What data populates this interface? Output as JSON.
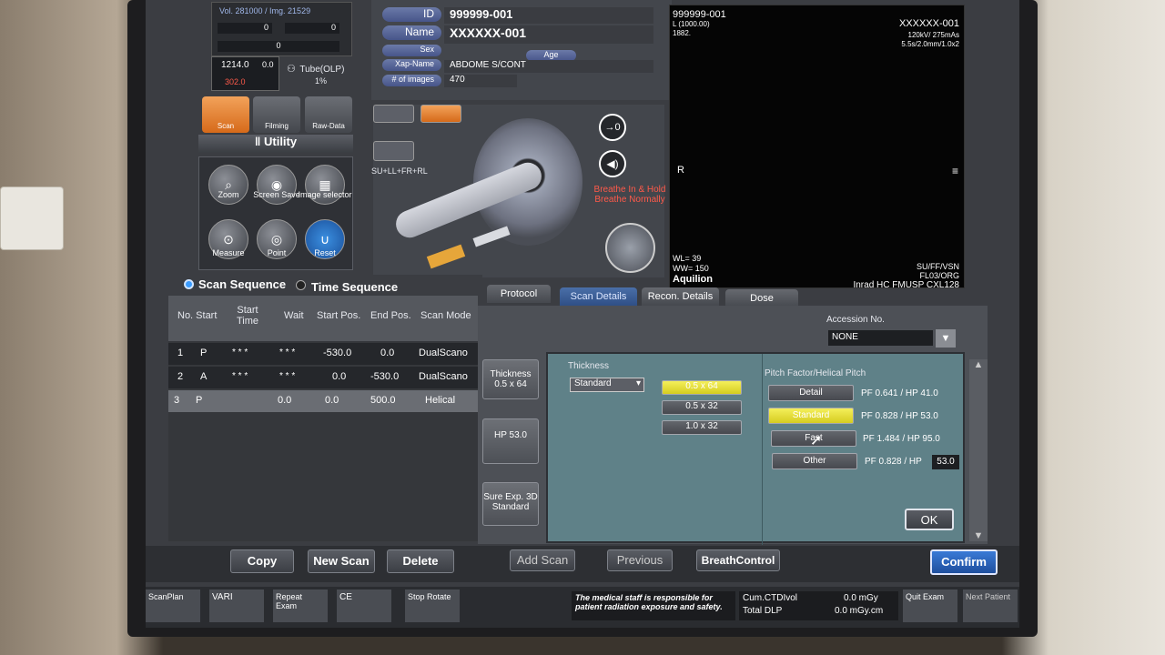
{
  "top_left": {
    "vol_text": "Vol. 281000 / Img. 21529",
    "counter_a": "0",
    "counter_b": "0",
    "counter_c": "0",
    "readout_top": "1214.0",
    "readout_mid": "0.0",
    "readout_bottom": "302.0",
    "tube_label": "Tube(OLP)",
    "tube_pct": "1%"
  },
  "main_tools": [
    {
      "label": "Scan"
    },
    {
      "label": "Filming"
    },
    {
      "label": "Raw-Data"
    }
  ],
  "utility": {
    "title": "Utility",
    "tools": [
      {
        "label": "Zoom"
      },
      {
        "label": "Screen Save"
      },
      {
        "label": "Image selector"
      },
      {
        "label": "Measure"
      },
      {
        "label": "Point"
      },
      {
        "label": "Reset"
      }
    ]
  },
  "patient": {
    "id_label": "ID",
    "id_value": "999999-001",
    "name_label": "Name",
    "name_value": "XXXXXX-001",
    "sex_label": "Sex",
    "age_label": "Age",
    "xap_label": "Xap-Name",
    "xap_value": "ABDOME S/CONT",
    "images_label": "# of images",
    "images_value": "470"
  },
  "breathe": {
    "line1": "Breathe In & Hold",
    "line2": "Breathe Normally"
  },
  "position_text": "SU+LL+FR+RL",
  "viewer": {
    "id": "999999-001",
    "l_value": "L (1000.00)",
    "num": "1882.",
    "right_id": "XXXXXX-001",
    "right_kv": "120kV/ 275mAs",
    "right_slice": "5.5s/2.0mm/1.0x2",
    "r_marker": "R",
    "wl": "WL= 39",
    "ww": "WW= 150",
    "model": "Aquilion",
    "bottom_right1": "SU/FF/VSN",
    "bottom_right2": "FL03/ORG",
    "institution": "Inrad HC FMUSP CXL128"
  },
  "sequence": {
    "scan_seq": "Scan Sequence",
    "time_seq": "Time Sequence",
    "headers": [
      "No. Start",
      "Start Time",
      "Wait",
      "Start Pos.",
      "End Pos.",
      "Scan Mode"
    ],
    "rows": [
      {
        "no": "1",
        "start": "P",
        "time": "* * *",
        "wait": "* * *",
        "spos": "-530.0",
        "epos": "0.0",
        "mode": "DualScano"
      },
      {
        "no": "2",
        "start": "A",
        "time": "* * *",
        "wait": "* * *",
        "spos": "0.0",
        "epos": "-530.0",
        "mode": "DualScano"
      },
      {
        "no": "3",
        "start": "P",
        "time": "",
        "wait": "0.0",
        "spos": "0.0",
        "epos": "500.0",
        "mode": "Helical"
      }
    ]
  },
  "tabs": [
    {
      "label": "Protocol"
    },
    {
      "label": "Scan Details"
    },
    {
      "label": "Recon. Details"
    },
    {
      "label": "Dose"
    }
  ],
  "accession": {
    "label": "Accession No.",
    "value": "NONE"
  },
  "side_buttons": [
    {
      "label": "Thickness 0.5 x 64"
    },
    {
      "label": "HP 53.0"
    },
    {
      "label": "Sure Exp. 3D Standard"
    }
  ],
  "thickness": {
    "title": "Thickness",
    "dropdown": "Standard",
    "options": [
      "0.5 x 64",
      "0.5 x 32",
      "1.0 x 32"
    ],
    "selected_index": 0
  },
  "pitch": {
    "title": "Pitch Factor/Helical Pitch",
    "options": [
      {
        "label": "Detail",
        "value": "PF 0.641 / HP 41.0"
      },
      {
        "label": "Standard",
        "value": "PF 0.828 / HP 53.0"
      },
      {
        "label": "Fast",
        "value": "PF 1.484 / HP 95.0"
      },
      {
        "label": "Other",
        "value": "PF 0.828 / HP"
      }
    ],
    "selected_index": 1,
    "other_input": "53.0",
    "ok": "OK"
  },
  "actions": {
    "copy": "Copy",
    "new_scan": "New Scan",
    "delete": "Delete",
    "add_scan": "Add Scan",
    "previous": "Previous",
    "breath": "BreathControl",
    "confirm": "Confirm"
  },
  "footer": {
    "scanplan": "ScanPlan",
    "vari": "VARI",
    "repeat": "Repeat Exam",
    "ce": "CE",
    "stop": "Stop Rotate",
    "notice": "The medical staff is responsible for patient radiation exposure and safety.",
    "ctdi_label": "Cum.CTDIvol",
    "ctdi_value": "0.0 mGy",
    "dlp_label": "Total DLP",
    "dlp_value": "0.0 mGy.cm",
    "quit": "Quit Exam",
    "next": "Next Patient"
  },
  "colors": {
    "accent_blue": "#3a6cc0",
    "highlight_yellow": "#e6df35",
    "panel_teal": "#5f8188"
  }
}
